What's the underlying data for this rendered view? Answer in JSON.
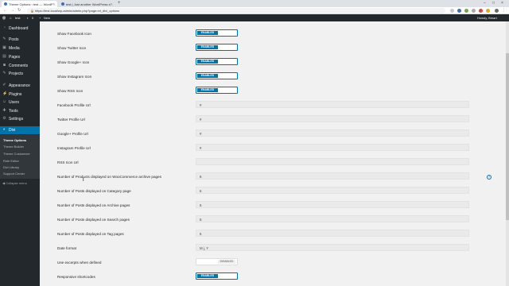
{
  "browser": {
    "tabs": [
      {
        "title": "Theme Options ‹ test — WordP…",
        "active": true
      },
      {
        "title": "test | Just another WordPress s…",
        "active": false
      }
    ],
    "address": "https://test.local/wp-admin/admin.php?page=et_divi_options",
    "new_tab_icon": "plus-icon"
  },
  "adminbar": {
    "site_name": "test",
    "comments_count": "0",
    "new_label": "New",
    "howdy": "Howdy, Bmart"
  },
  "sidebar": {
    "items": [
      {
        "label": "Dashboard",
        "icon": "dashboard-icon"
      },
      {
        "label": "Posts",
        "icon": "pin-icon"
      },
      {
        "label": "Media",
        "icon": "media-icon"
      },
      {
        "label": "Pages",
        "icon": "page-icon"
      },
      {
        "label": "Comments",
        "icon": "comment-icon"
      },
      {
        "label": "Projects",
        "icon": "projects-icon"
      },
      {
        "label": "Appearance",
        "icon": "brush-icon"
      },
      {
        "label": "Plugins",
        "icon": "plugin-icon"
      },
      {
        "label": "Users",
        "icon": "users-icon"
      },
      {
        "label": "Tools",
        "icon": "wrench-icon"
      },
      {
        "label": "Settings",
        "icon": "settings-icon"
      },
      {
        "label": "Divi",
        "icon": "divi-icon"
      }
    ],
    "submenu": [
      "Theme Options",
      "Theme Builder",
      "Theme Customizer",
      "Role Editor",
      "Divi Library",
      "Support Center"
    ],
    "collapse_label": "Collapse menu"
  },
  "options": {
    "toggles": [
      {
        "label": "Show Facebook Icon",
        "state": "ENABLED"
      },
      {
        "label": "Show Twitter Icon",
        "state": "ENABLED"
      },
      {
        "label": "Show Google+ Icon",
        "state": "ENABLED"
      },
      {
        "label": "Show Instagram Icon",
        "state": "ENABLED"
      },
      {
        "label": "Show RSS Icon",
        "state": "ENABLED"
      }
    ],
    "fields": [
      {
        "label": "Facebook Profile Url",
        "value": "#"
      },
      {
        "label": "Twitter Profile Url",
        "value": "#"
      },
      {
        "label": "Google+ Profile Url",
        "value": "#"
      },
      {
        "label": "Instagram Profile Url",
        "value": "#"
      },
      {
        "label": "RSS Icon Url",
        "value": ""
      },
      {
        "label": "Number of Products displayed on WooCommerce archive pages",
        "value": "9"
      },
      {
        "label": "Number of Posts displayed on Category page",
        "value": "6"
      },
      {
        "label": "Number of Posts displayed on Archive pages",
        "value": "5"
      },
      {
        "label": "Number of Posts displayed on Search pages",
        "value": "5"
      },
      {
        "label": "Number of Posts displayed on Tag pages",
        "value": "5"
      },
      {
        "label": "Date format",
        "value": "M j, Y"
      }
    ],
    "excerpts": {
      "label": "Use excerpts when defined",
      "state": "DISABLED"
    },
    "shortcodes": {
      "label": "Responsive shortcodes",
      "state": "ENABLED"
    }
  },
  "colors": {
    "accent": "#0073aa",
    "admin_dark": "#23282d"
  }
}
